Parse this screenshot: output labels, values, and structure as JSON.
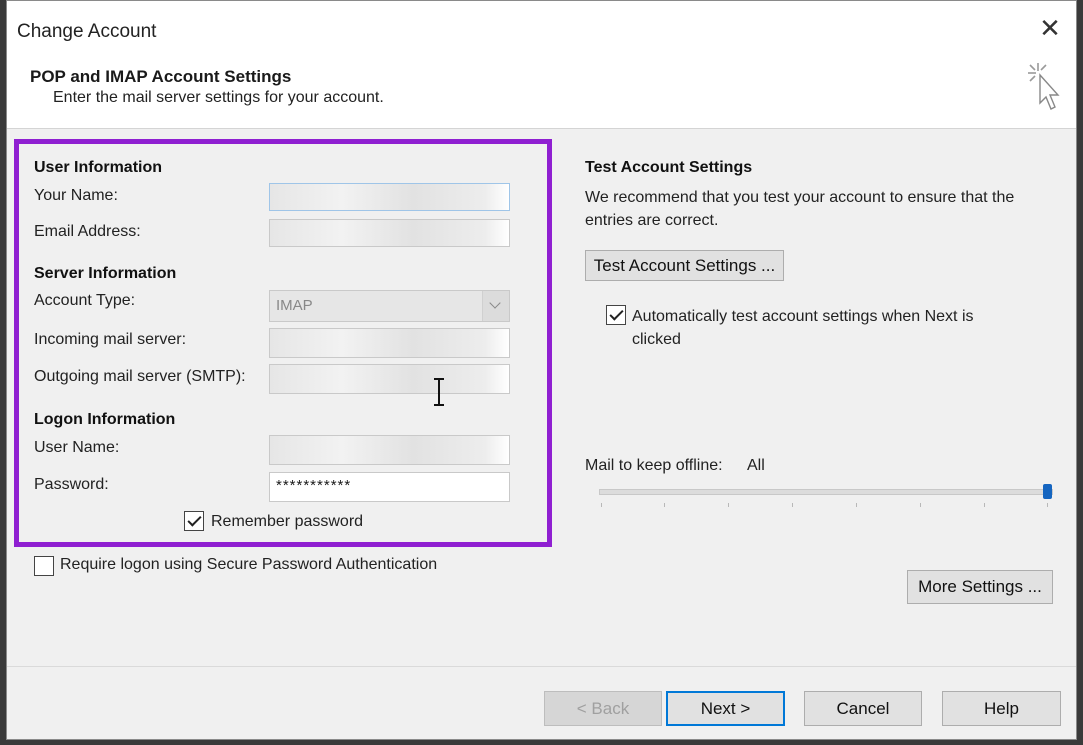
{
  "window": {
    "title": "Change Account"
  },
  "header": {
    "title": "POP and IMAP Account Settings",
    "subtitle": "Enter the mail server settings for your account."
  },
  "user_info": {
    "heading": "User Information",
    "name_label": "Your Name:",
    "name_value": "",
    "email_label": "Email Address:",
    "email_value": ""
  },
  "server_info": {
    "heading": "Server Information",
    "account_type_label": "Account Type:",
    "account_type_value": "IMAP",
    "incoming_label": "Incoming mail server:",
    "incoming_value": "",
    "outgoing_label": "Outgoing mail server (SMTP):",
    "outgoing_value": ""
  },
  "logon_info": {
    "heading": "Logon Information",
    "username_label": "User Name:",
    "username_value": "",
    "password_label": "Password:",
    "password_value": "***********",
    "remember_label": "Remember password",
    "remember_checked": true
  },
  "spa": {
    "label": "Require logon using Secure Password Authentication",
    "checked": false
  },
  "test": {
    "heading": "Test Account Settings",
    "description": "We recommend that you test your account to ensure that the entries are correct.",
    "button_label": "Test Account Settings ...",
    "auto_label": "Automatically test account settings when Next is clicked",
    "auto_checked": true
  },
  "offline": {
    "label": "Mail to keep offline:",
    "value": "All",
    "slider_fraction": 1.0
  },
  "more_settings_label": "More Settings ...",
  "footer": {
    "back_label": "< Back",
    "next_label": "Next >",
    "cancel_label": "Cancel",
    "help_label": "Help"
  },
  "colors": {
    "highlight": "#8f1fd1",
    "primary_border": "#0078d7",
    "slider_thumb": "#1565c0"
  }
}
